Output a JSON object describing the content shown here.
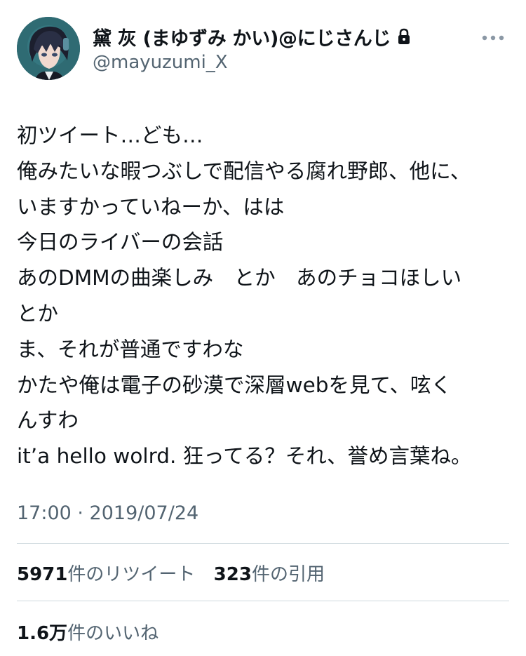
{
  "user": {
    "display_name": "黛 灰 (まゆずみ かい)@にじさんじ",
    "handle": "@mayuzumi_X"
  },
  "tweet": {
    "lines": [
      "初ツイート…ども…",
      "俺みたいな暇つぶしで配信やる腐れ野郎、他に、",
      "いますかっていねーか、はは",
      "今日のライバーの会話",
      "あのDMMの曲楽しみ　とか　あのチョコほしい",
      "とか",
      "ま、それが普通ですわな",
      "かたや俺は電子の砂漠で深層webを見て、呟く",
      "んすわ",
      "it’a hello wolrd.  狂ってる？それ、誉め言葉ね。"
    ],
    "timestamp": "17:00 · 2019/07/24"
  },
  "stats": {
    "retweets_count": "5971",
    "retweets_label": "件のリツイート",
    "quotes_count": "323",
    "quotes_label": "件の引用",
    "likes_count": "1.6万",
    "likes_label": "件のいいね"
  },
  "icons": {
    "lock": "lock-icon",
    "more": "more-options-icon"
  },
  "colors": {
    "text_primary": "#0f1419",
    "text_secondary": "#536471",
    "divider": "#cfd9de",
    "avatar_bg": "#2f6b73"
  }
}
